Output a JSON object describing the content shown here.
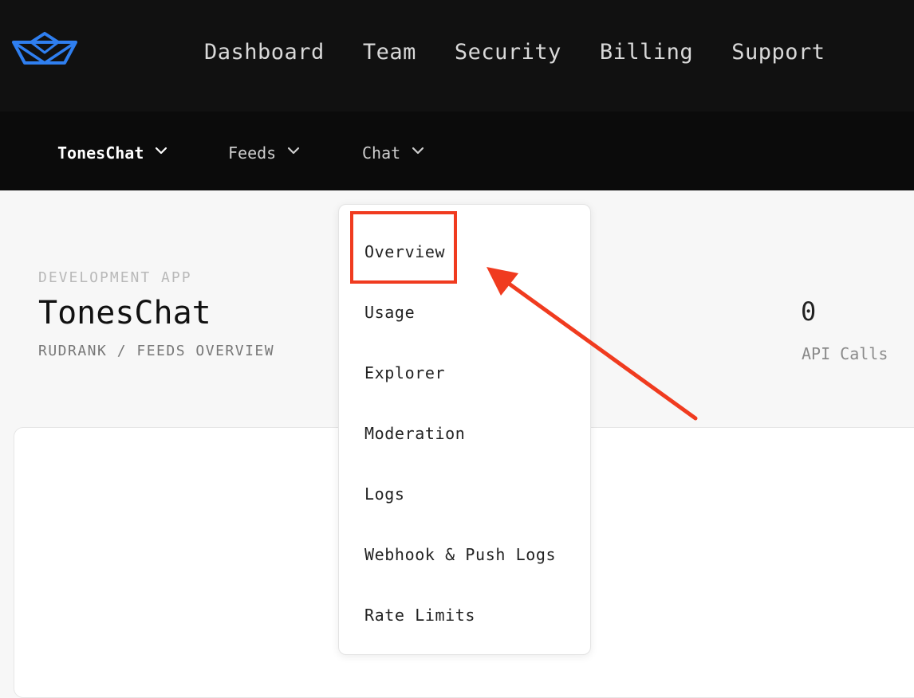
{
  "topnav": {
    "items": [
      {
        "label": "Dashboard"
      },
      {
        "label": "Team"
      },
      {
        "label": "Security"
      },
      {
        "label": "Billing"
      },
      {
        "label": "Support"
      }
    ]
  },
  "subnav": {
    "items": [
      {
        "label": "TonesChat",
        "active": true
      },
      {
        "label": "Feeds",
        "active": false
      },
      {
        "label": "Chat",
        "active": false
      }
    ]
  },
  "header": {
    "eyebrow": "DEVELOPMENT APP",
    "title": "TonesChat",
    "breadcrumb": "RUDRANK / FEEDS OVERVIEW"
  },
  "stats": {
    "api_calls_value": "0",
    "api_calls_label": "API Calls"
  },
  "dropdown": {
    "items": [
      {
        "label": "Overview"
      },
      {
        "label": "Usage"
      },
      {
        "label": "Explorer"
      },
      {
        "label": "Moderation"
      },
      {
        "label": "Logs"
      },
      {
        "label": "Webhook & Push Logs"
      },
      {
        "label": "Rate Limits"
      }
    ]
  },
  "colors": {
    "logo_blue": "#2f7ff0",
    "annotation_red": "#f03b1f",
    "topbar_bg": "#111111"
  },
  "icons": {
    "logo": "paper-boat-logo",
    "dropdown_caret": "chevron-down-icon"
  }
}
